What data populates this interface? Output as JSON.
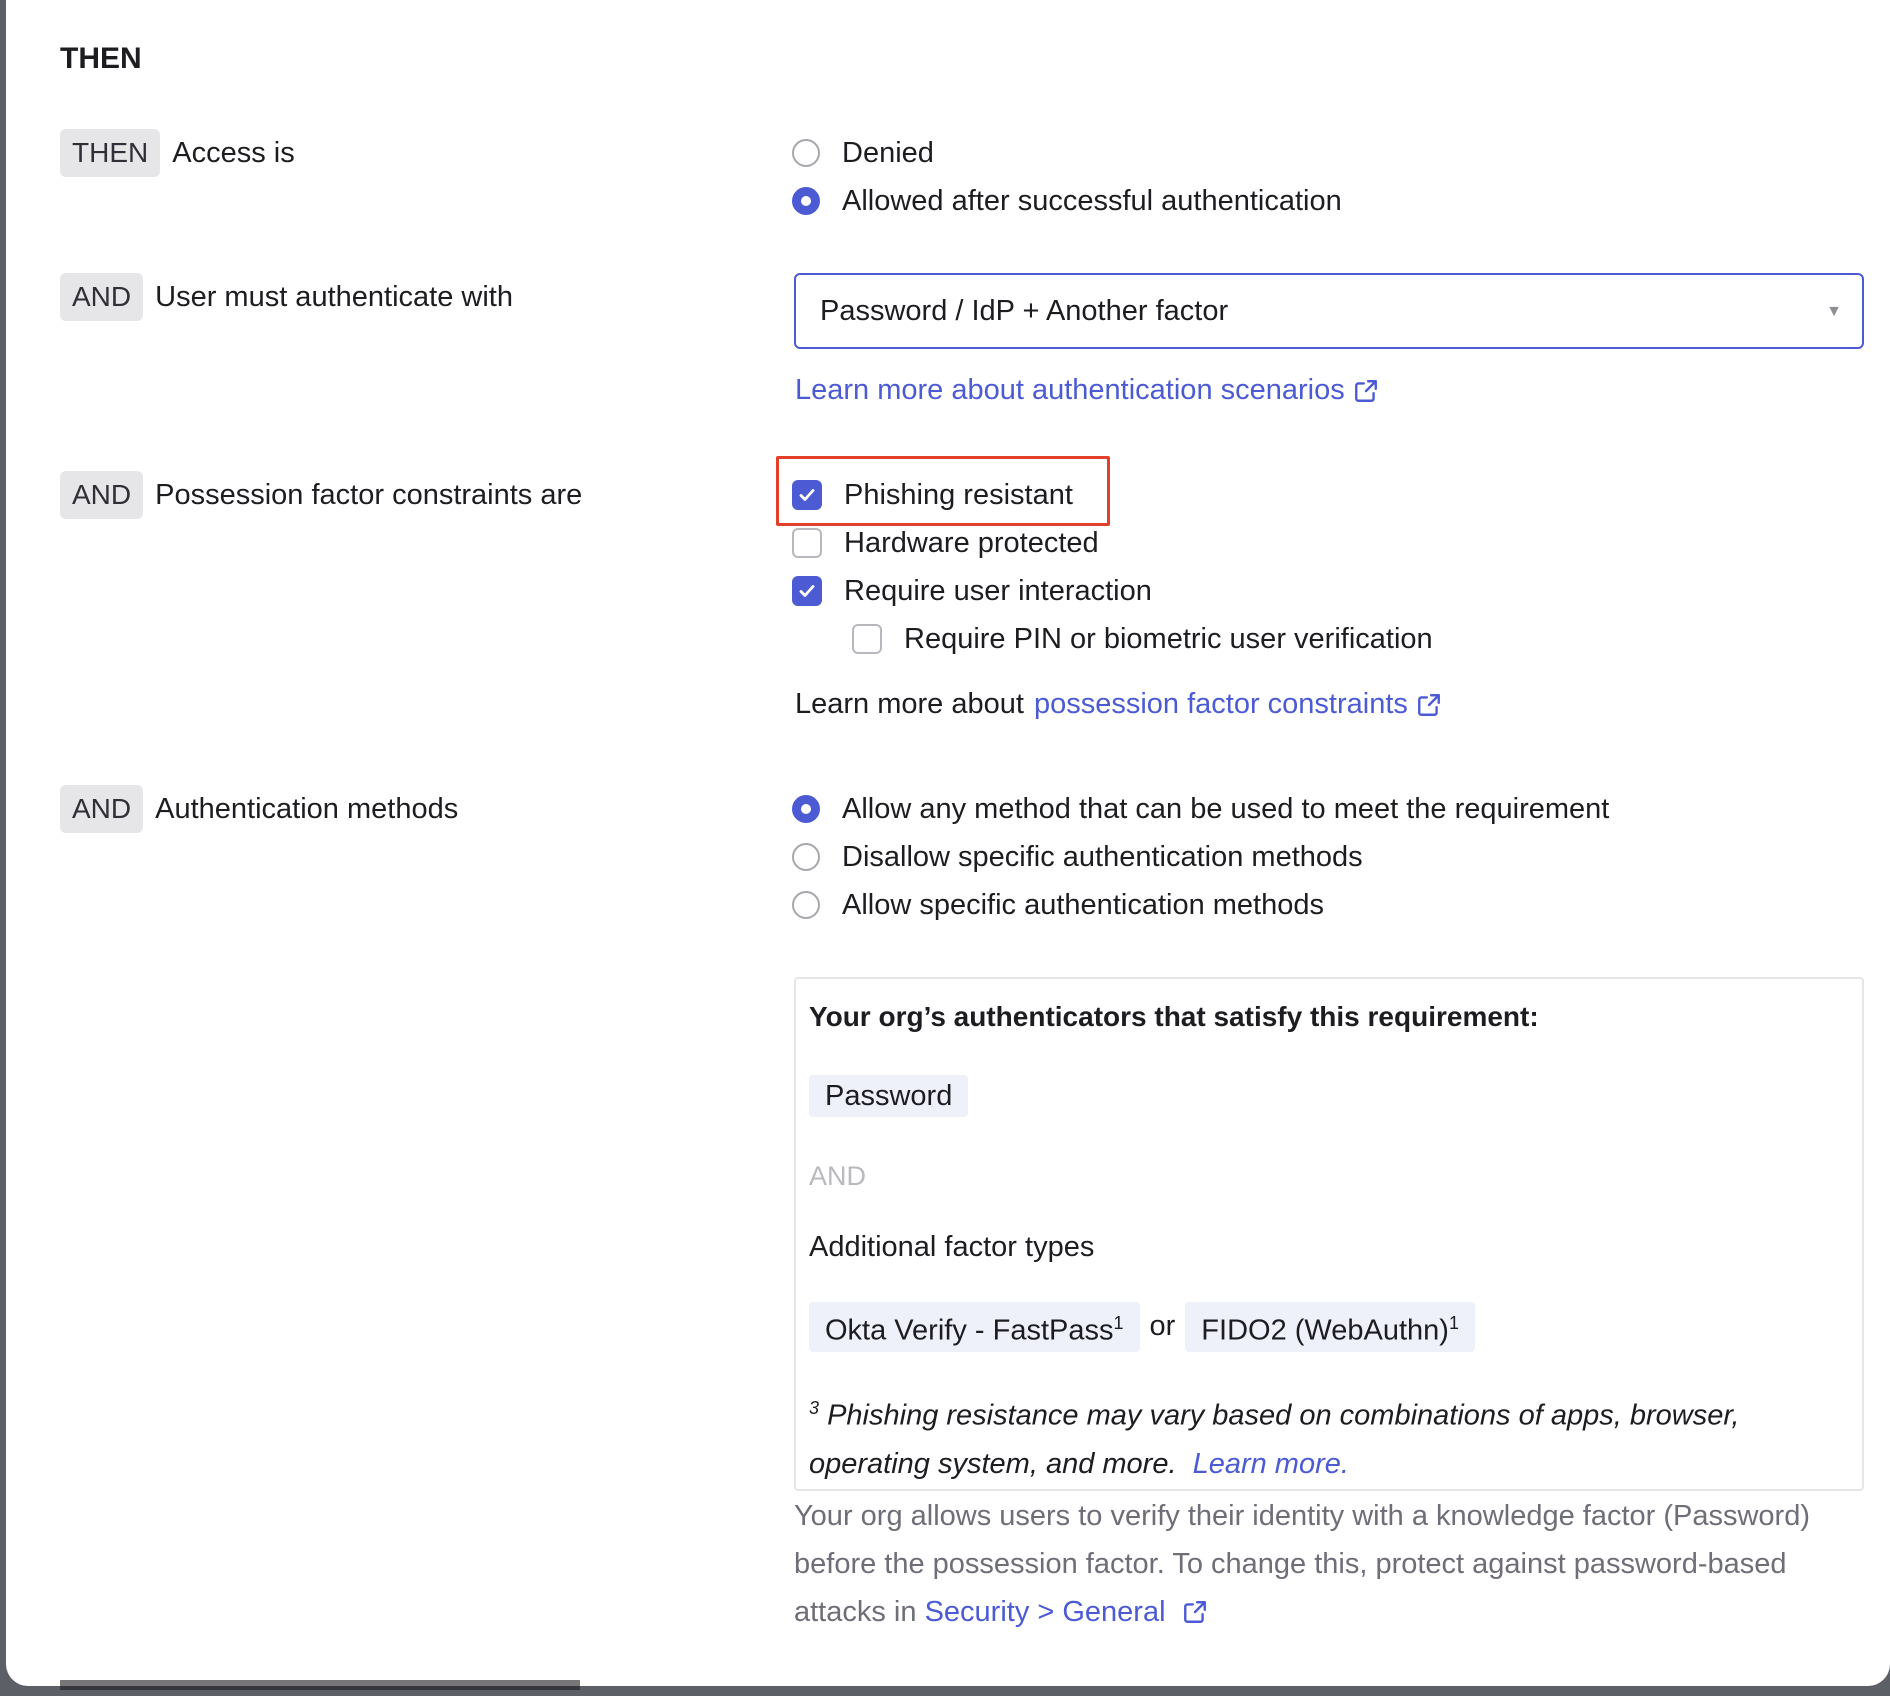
{
  "section": {
    "title": "THEN"
  },
  "rows": {
    "access": {
      "pill": "THEN",
      "label": "Access is",
      "options": [
        "Denied",
        "Allowed after successful authentication"
      ],
      "selected": 1
    },
    "authenticate": {
      "pill": "AND",
      "label": "User must authenticate with",
      "select_value": "Password / IdP + Another factor",
      "link": "Learn more about authentication scenarios"
    },
    "possession": {
      "pill": "AND",
      "label": "Possession factor constraints are",
      "options": [
        "Phishing resistant",
        "Hardware protected",
        "Require user interaction",
        "Require PIN or biometric user verification"
      ],
      "checked": [
        true,
        false,
        true,
        false
      ],
      "learn_prefix": "Learn more about",
      "learn_link": "possession factor constraints"
    },
    "methods": {
      "pill": "AND",
      "label": "Authentication methods",
      "options": [
        "Allow any method that can be used to meet the requirement",
        "Disallow specific authentication methods",
        "Allow specific authentication methods"
      ],
      "selected": 0
    }
  },
  "authenticators": {
    "heading": "Your org’s authenticators that satisfy this requirement:",
    "knowledge": "Password",
    "and": "AND",
    "additional": "Additional factor types",
    "factor1": "Okta Verify - FastPass",
    "factor1_sup": "1",
    "or": "or",
    "factor2": "FIDO2 (WebAuthn)",
    "factor2_sup": "1",
    "note_sup": "3",
    "note": "Phishing resistance may vary based on combinations of apps, browser, operating system, and more.",
    "note_link": "Learn more."
  },
  "footer": {
    "text": "Your org allows users to verify their identity with a knowledge factor (Password) before the possession factor. To change this, protect against password-based attacks in",
    "link": "Security > General"
  },
  "colors": {
    "accent": "#4c5bd4",
    "highlight": "#e2402a",
    "pill_bg": "#e6e6e8"
  }
}
